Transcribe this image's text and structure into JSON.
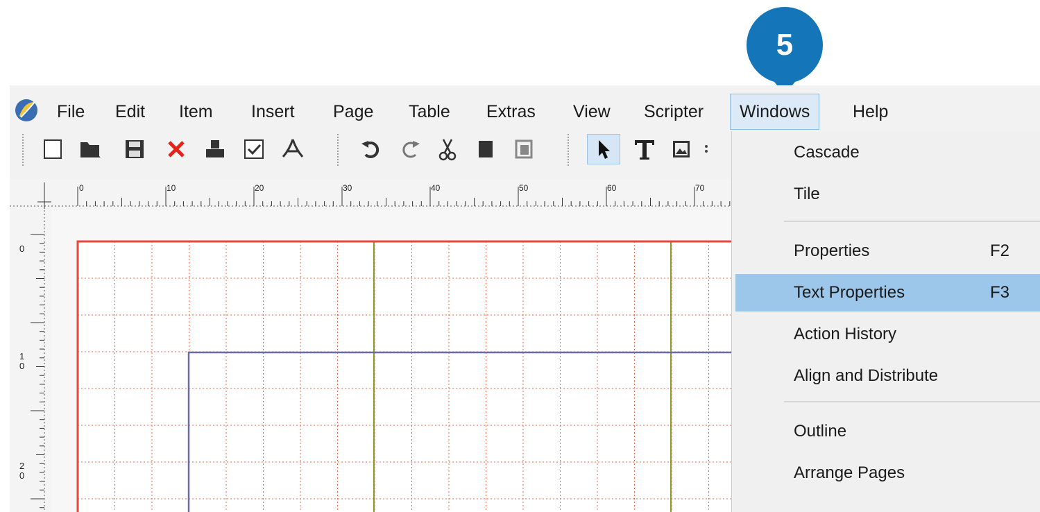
{
  "menubar": {
    "items": [
      "File",
      "Edit",
      "Item",
      "Insert",
      "Page",
      "Table",
      "Extras",
      "View",
      "Scripter",
      "Windows",
      "Help"
    ],
    "active": "Windows"
  },
  "toolbar": {
    "icons": [
      "new-document-icon",
      "open-folder-icon",
      "save-icon",
      "close-document-icon",
      "print-icon",
      "preflight-check-icon",
      "export-pdf-icon",
      "undo-icon",
      "redo-icon",
      "cut-icon",
      "copy-icon",
      "paste-icon",
      "select-arrow-icon",
      "text-frame-icon",
      "image-frame-icon"
    ]
  },
  "ruler": {
    "horizontal_labels": [
      "0",
      "10",
      "20",
      "30",
      "40",
      "50",
      "60",
      "70"
    ],
    "vertical_labels": [
      "0",
      "1\n0",
      "2\n0"
    ]
  },
  "windows_menu": {
    "items": [
      {
        "label": "Cascade",
        "shortcut": ""
      },
      {
        "label": "Tile",
        "shortcut": ""
      },
      {
        "label": "Properties",
        "shortcut": "F2"
      },
      {
        "label": "Text Properties",
        "shortcut": "F3",
        "highlighted": true
      },
      {
        "label": "Action History",
        "shortcut": ""
      },
      {
        "label": "Align and Distribute",
        "shortcut": ""
      },
      {
        "label": "Outline",
        "shortcut": ""
      },
      {
        "label": "Arrange Pages",
        "shortcut": ""
      }
    ]
  },
  "callout": {
    "number": "5",
    "color": "#1476b8"
  },
  "colors": {
    "highlight": "#9cc6ea",
    "page_border": "#e8483a",
    "grid_major": "#e86a4a",
    "guide_green": "#8a9a2a",
    "margin_blue": "#6a6aa8"
  }
}
